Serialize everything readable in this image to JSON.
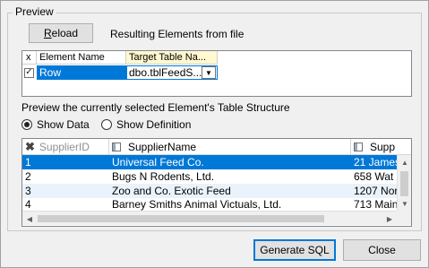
{
  "group": {
    "title": "Preview"
  },
  "toolbar": {
    "reload_label": "Reload",
    "result_label": "Resulting Elements from file"
  },
  "mapping": {
    "headers": {
      "check": "x",
      "element": "Element Name",
      "target": "Target Table Na..."
    },
    "row": {
      "checked": true,
      "element": "Row",
      "target": "dbo.tblFeedS..."
    }
  },
  "preview": {
    "label": "Preview the currently selected Element's Table Structure",
    "options": [
      {
        "label": "Show Data",
        "selected": true
      },
      {
        "label": "Show Definition",
        "selected": false
      }
    ]
  },
  "datagrid": {
    "columns": [
      "SupplierID",
      "SupplierName",
      "Supp"
    ],
    "rows": [
      {
        "id": "1",
        "name": "Universal Feed Co.",
        "supp": "21 James"
      },
      {
        "id": "2",
        "name": "Bugs N Rodents, Ltd.",
        "supp": "658 Wat"
      },
      {
        "id": "3",
        "name": "Zoo and Co. Exotic Feed",
        "supp": "1207 Nor"
      },
      {
        "id": "4",
        "name": "Barney Smiths Animal Victuals, Ltd.",
        "supp": "713 Main"
      }
    ]
  },
  "footer": {
    "generate_label": "Generate SQL",
    "close_label": "Close"
  },
  "colors": {
    "selection": "#0078d7",
    "alt_row": "#eaf3fb",
    "focus": "#0078d7"
  }
}
